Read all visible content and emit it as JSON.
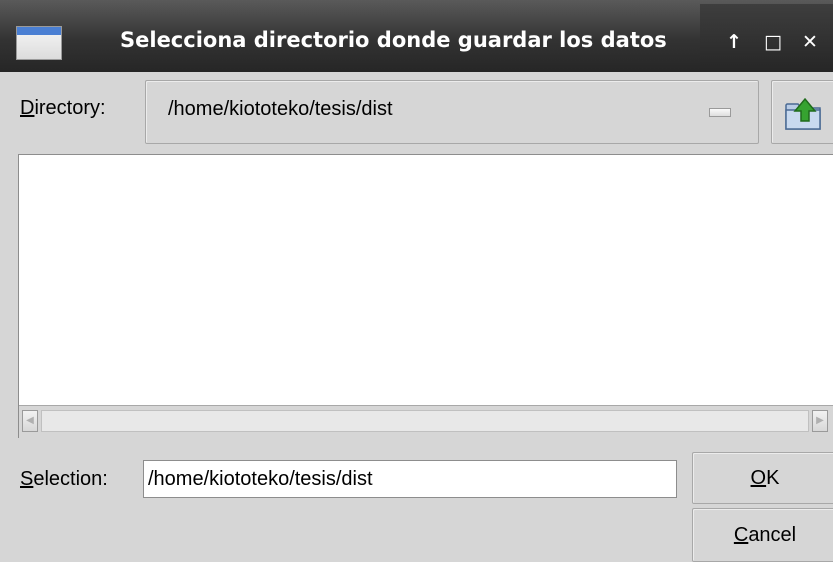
{
  "window": {
    "title": "Selecciona directorio donde guardar los datos",
    "controls": {
      "maximize_glyph": "↑",
      "restore_glyph": "□",
      "close_glyph": "✕"
    }
  },
  "directory": {
    "label_mnemonic": "D",
    "label_rest": "irectory:",
    "path": "/home/kiototeko/tesis/dist",
    "up_button_icon": "folder-up-icon"
  },
  "file_list": {
    "items": [],
    "scroll_left_glyph": "◀",
    "scroll_right_glyph": "▶"
  },
  "selection": {
    "label_mnemonic": "S",
    "label_rest": "election:",
    "value": "/home/kiototeko/tesis/dist"
  },
  "buttons": {
    "ok_mnemonic": "O",
    "ok_rest": "K",
    "cancel_mnemonic": "C",
    "cancel_rest": "ancel"
  },
  "colors": {
    "titlebar": "#333333",
    "background": "#d6d6d6",
    "folder_icon_accent": "#36a330"
  }
}
